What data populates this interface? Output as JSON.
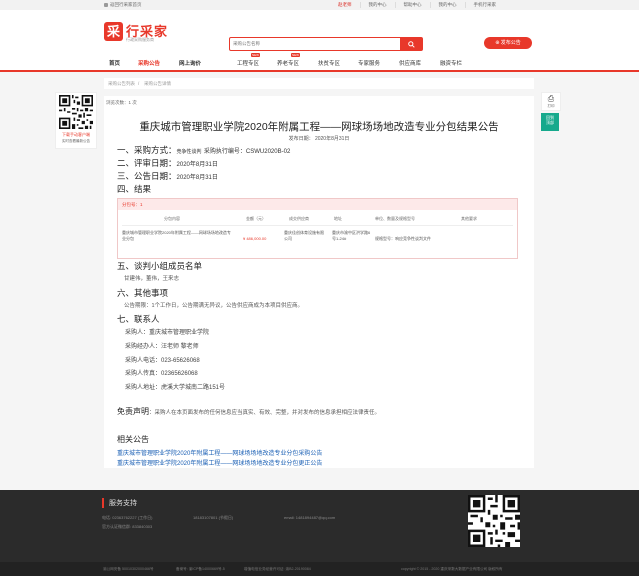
{
  "topbar": {
    "home": "返回行采家首页",
    "user": "赵老师",
    "links": [
      "我的中心",
      "帮助中心",
      "我的中心",
      "手机行采家"
    ]
  },
  "logo": {
    "mark": "采",
    "name": "行采家",
    "slogan": "行政采购服务商"
  },
  "search": {
    "placeholder": "采购公告名称",
    "button_icon": "search-icon"
  },
  "publish_button": "发布公告",
  "nav": {
    "items": [
      "首页",
      "采购公告",
      "网上询价",
      "工程专区",
      "养老专区",
      "扶贫专区",
      "专家服务",
      "供应商库",
      "融资专栏"
    ],
    "hot_badge": "NEW"
  },
  "breadcrumb": [
    "采购公告列表",
    "采购公告详情"
  ],
  "side_qr": {
    "line1": "下载手动客户端",
    "line2": "实时查看最新公告"
  },
  "print_label": "打印",
  "back_label": [
    "回到",
    "顶部"
  ],
  "views": "浏览次数：1 次",
  "article": {
    "title": "重庆城市管理职业学院2020年附属工程——网球场场地改造专业分包结果公告",
    "pubdate": "发布日期： 2020年8月31日",
    "s1_label": "一、采购方式：",
    "s1_method": "竞争性谈判",
    "s1_code_label": "采购执行编号：",
    "s1_code": "CSWU2020B-02",
    "s2_label": "二、评审日期：",
    "s2_value": "2020年8月31日",
    "s3_label": "三、公告日期：",
    "s3_value": "2020年8月31日",
    "s4_label": "四、结果",
    "result": {
      "package": "分包号：1",
      "headers": [
        "分包内容",
        "金额（元）",
        "成交供应商",
        "地址",
        "单位、数量及规格型号",
        "其他要求"
      ],
      "row": {
        "content": "重庆城市管理职业学院2020年附属工程——网球场场地改造专业分包",
        "amount": "¥ 486,000.00",
        "supplier": "重庆佳创体育设施有限公司",
        "address": "重庆市渝中区洪学路6号1-24#",
        "spec": "规格型号：响应竞争性谈判文件",
        "other": ""
      }
    },
    "s5_label": "五、谈判小组成员名单",
    "s5_value": "甘建伟，董伟，王来志",
    "s6_label": "六、其他事项",
    "s6_value": "公告期限：1个工作日，公告期满无异议，公告供应商成为本项目供应商。",
    "s7_label": "七、联系人",
    "contacts": [
      "采购人：重庆城市管理职业学院",
      "采购经办人：汪老师 黎老师",
      "采购人电话：023-65626068",
      "采购人传真：02365626068",
      "采购人地址：虎溪大学城南二路151号"
    ],
    "disclaimer_title": "免责声明",
    "disclaimer_text": "：采购人在本页面发布的任何信息应当真实、有效、完整，并对发布的信息承担相应法律责任。",
    "related_title": "相关公告",
    "related": [
      "重庆城市管理职业学院2020年附属工程——网球场场地改造专业分包采购公告",
      "重庆城市管理职业学院2020年附属工程——网球场场地改造专业分包更正公告"
    ]
  },
  "footer": {
    "service": "服务支持",
    "phone": "电话: 02363762227 (工作日)",
    "mobile": "18183107801 (节假日)",
    "email": "email: 1481894487@qq.com",
    "qq": "官方认证微信群: 833840303",
    "bottom": [
      "渝公网安备 50010302000466号",
      "备案号: 渝ICP备14000669号-5",
      "增值电信业务经营许可证: 渝B2-20190084",
      "copyright © 2015 - 2020 重庆采数大数据产业有限公司 版权所有"
    ]
  },
  "colors": {
    "accent": "#e8382a",
    "link": "#1a5fb4",
    "back_top": "#16a98c",
    "footer": "#2b2b2b"
  }
}
